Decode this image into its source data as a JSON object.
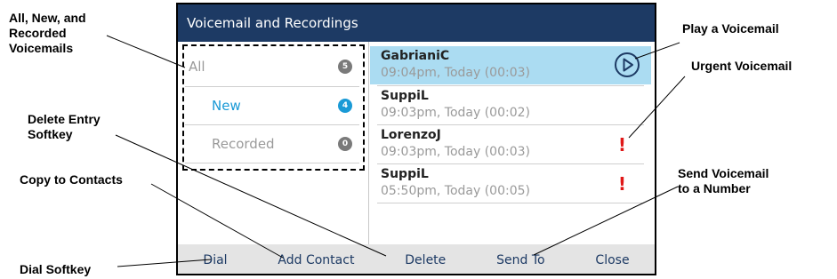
{
  "screen": {
    "title": "Voicemail and Recordings",
    "filters": [
      {
        "label": "All",
        "count": "5",
        "color": "#9a9a9a",
        "badge": "#7a7a7a"
      },
      {
        "label": "New",
        "count": "4",
        "color": "#1a9ad6",
        "badge": "#1a9ad6"
      },
      {
        "label": "Recorded",
        "count": "0",
        "color": "#9a9a9a",
        "badge": "#7a7a7a"
      }
    ],
    "entries": [
      {
        "name": "GabrianiC",
        "meta": "09:04pm, Today (00:03)",
        "urgent": ""
      },
      {
        "name": "SuppiL",
        "meta": "09:03pm, Today (00:02)",
        "urgent": ""
      },
      {
        "name": "LorenzoJ",
        "meta": "09:03pm, Today (00:03)",
        "urgent": "!"
      },
      {
        "name": "SuppiL",
        "meta": "05:50pm, Today (00:05)",
        "urgent": "!"
      }
    ],
    "softkeys": [
      "Dial",
      "Add Contact",
      "Delete",
      "Send To",
      "Close"
    ]
  },
  "callouts": {
    "all_new_recorded": "All, New, and\nRecorded\nVoicemails",
    "delete_entry": "Delete Entry\n Softkey",
    "copy_contacts": "Copy to Contacts",
    "dial_softkey": "Dial Softkey",
    "play_voicemail": "Play a Voicemail",
    "urgent_voicemail": "Urgent Voicemail",
    "send_voicemail": "Send Voicemail\nto a Number"
  },
  "colors": {
    "titlebar": "#1d3a64",
    "selected": "#abdcf2",
    "urgent": "#e01818",
    "accent": "#1a9ad6"
  }
}
